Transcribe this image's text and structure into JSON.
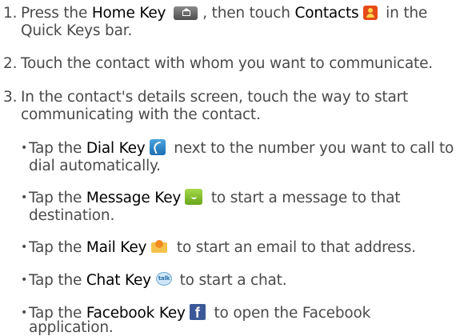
{
  "steps": [
    {
      "number": "1.",
      "parts": [
        "Press the ",
        "Home Key",
        ", then touch ",
        "Contacts",
        " in the",
        "Quick Keys bar."
      ]
    },
    {
      "number": "2.",
      "text": "Touch the contact with whom you want to communicate."
    },
    {
      "number": "3.",
      "line1": "In the contact's details screen, touch the way to start",
      "line2": "communicating with the contact."
    }
  ],
  "bullets": {
    "dot": "•",
    "dial": {
      "pre": "Tap the ",
      "key": "Dial Key",
      "post1": " next to the number you want to call to",
      "post2": "dial automatically.",
      "icon": "dial-key-icon"
    },
    "message": {
      "pre": "Tap the ",
      "key": "Message Key",
      "post1": " to start a message to that",
      "post2": "destination.",
      "icon": "message-key-icon"
    },
    "mail": {
      "pre": "Tap the ",
      "key": "Mail Key",
      "post1": " to start an email to that address.",
      "icon": "mail-key-icon"
    },
    "chat": {
      "pre": "Tap the ",
      "key": "Chat Key",
      "post1": " to start a chat.",
      "icon": "chat-key-icon",
      "icon_text": "talk"
    },
    "facebook": {
      "pre": "Tap the ",
      "key": "Facebook Key",
      "post1": " to open the Facebook",
      "post2": "application.",
      "icon": "facebook-key-icon",
      "icon_text": "f"
    }
  },
  "icons": {
    "home_key": "home-key-icon",
    "contacts": "contacts-icon"
  },
  "colors": {
    "body_text": "#4a4a4a",
    "key_text": "#000000"
  }
}
